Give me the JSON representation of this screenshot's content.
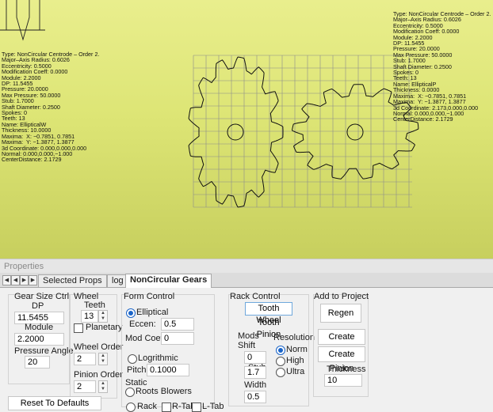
{
  "viewport": {
    "info_left": "Type: NonCircular Centrode – Order 2.\nMajor–Axis Radius: 0.6026\nEccentricity: 0.5000\nModification Coeff: 0.0000\nModule: 2.2000\nDP: 11.5455\nPressure: 20.0000\nMax Pressure: 50.0000\nStub: 1.7000\nShaft Diameter: 0.2500\nSpokes: 0\nTeeth: 13\nName: EllipticalW\nThickness: 10.0000\nMaxima:  X: −0.7851, 0.7851\nMaxima:  Y: −1.3877, 1.3877\n3d Coordinate: 0.000,0.000,0.000\nNormal: 0.000,0.000,−1.000\nCenterDistance: 2.1729",
    "info_right": "Type: NonCircular Centrode – Order 2.\nMajor–Axis Radius: 0.6026\nEccentricity: 0.5000\nModification Coeff: 0.0000\nModule: 2.2000\nDP: 11.5455\nPressure: 20.0000\nMax Pressure: 50.0000\nStub: 1.7000\nShaft Diameter: 0.2500\nSpokes: 0\nTeeth: 13\nName: EllipticalP\nThickness: 0.0000\nMaxima:  X: −0.7851, 0.7851\nMaxima:  Y: −1.3877, 1.3877\n3d Coordinate: 2.173,0.000,0.000\nNormal: 0.000,0.000,−1.000\nCenterDistance: 2.1729",
    "colors": {
      "background_top": "#e9ee8d",
      "background_bottom": "#c7cf5e",
      "gear_outline": "#111111",
      "grid": "#8c8c8c"
    }
  },
  "properties": {
    "title": "Properties",
    "tabs": [
      "Selected Props",
      "log",
      "NonCircular Gears"
    ],
    "active_tab": "NonCircular Gears"
  },
  "gear_size": {
    "title": "Gear Size Ctrl",
    "dp_label": "DP",
    "dp_value": "11.5455",
    "module_label": "Module",
    "module_value": "2.2000",
    "pressure_label": "Pressure Angle",
    "pressure_value": "20"
  },
  "wheel": {
    "title": "Wheel",
    "teeth_label": "Teeth",
    "teeth_value": "13",
    "planetary_label": "Planetary",
    "wheel_order_label": "Wheel Order",
    "wheel_order_value": "2",
    "pinion_order_label": "Pinion Order",
    "pinion_order_value": "2"
  },
  "form": {
    "title": "Form Control",
    "elliptical_label": "Elliptical",
    "eccen_label": "Eccen:",
    "eccen_value": "0.5",
    "modcoeff_label": "Mod Coeff",
    "modcoeff_value": "0",
    "log_label": "Logrithmic",
    "pitch_label": "Pitch",
    "pitch_value": "0.1000",
    "static_label": "Static",
    "roots_label": "Roots Blowers",
    "rack_label": "Rack",
    "rtab_label": "R-Tab",
    "ltab_label": "L-Tab"
  },
  "rack": {
    "title": "Rack Control",
    "tooth_wheel_label": "Tooth Wheel",
    "tooth_pinion_label": "Tooth Pinion",
    "mods_shift_label": "Mods\nShift",
    "shift_value": "0",
    "stub_label": "Stub",
    "stub_value": "1.7",
    "width_label": "Width",
    "width_value": "0.5",
    "resolution_label": "Resolution",
    "norm_label": "Norm",
    "high_label": "High",
    "ultra_label": "Ultra"
  },
  "project": {
    "title": "Add to Project",
    "regen_label": "Regen",
    "create_wheel_label": "Create Wheel",
    "create_pinion_label": "Create Pinion",
    "thickness_label": "Thickness",
    "thickness_value": "10"
  },
  "reset_label": "Reset To Defaults"
}
